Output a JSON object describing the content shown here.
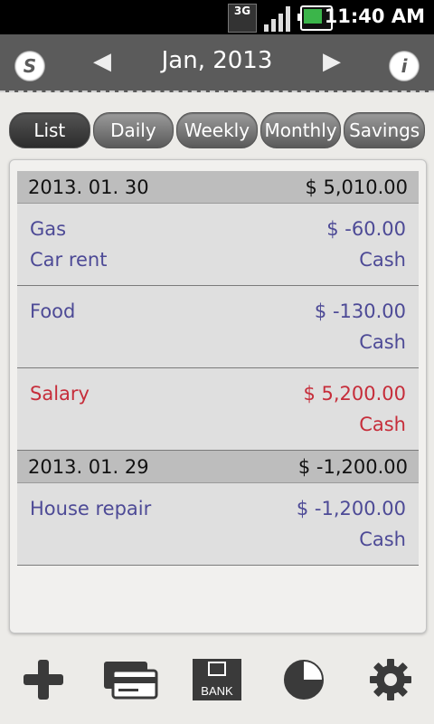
{
  "status": {
    "network": "3G",
    "time": "11:40 AM"
  },
  "header": {
    "left_button": "S",
    "right_button": "i",
    "prev_arrow": "◀",
    "next_arrow": "▶",
    "title": "Jan, 2013"
  },
  "tabs": [
    {
      "label": "List"
    },
    {
      "label": "Daily"
    },
    {
      "label": "Weekly"
    },
    {
      "label": "Monthly"
    },
    {
      "label": "Savings"
    }
  ],
  "groups": [
    {
      "date": "2013. 01. 30",
      "total": "$ 5,010.00",
      "entries": [
        {
          "line1": "Gas",
          "line2": "Car rent",
          "amount": "$ -60.00",
          "method": "Cash",
          "kind": "expense"
        },
        {
          "line1": "Food",
          "line2": "",
          "amount": "$ -130.00",
          "method": "Cash",
          "kind": "expense"
        },
        {
          "line1": "Salary",
          "line2": "",
          "amount": "$ 5,200.00",
          "method": "Cash",
          "kind": "income"
        }
      ]
    },
    {
      "date": "2013. 01. 29",
      "total": "$ -1,200.00",
      "entries": [
        {
          "line1": "House repair",
          "line2": "",
          "amount": "$ -1,200.00",
          "method": "Cash",
          "kind": "expense"
        }
      ]
    }
  ],
  "toolbar": {
    "bank_label": "BANK"
  },
  "colors": {
    "expense": "#4d4a96",
    "income": "#c62d3a",
    "header_bg": "#5b5b5b"
  }
}
